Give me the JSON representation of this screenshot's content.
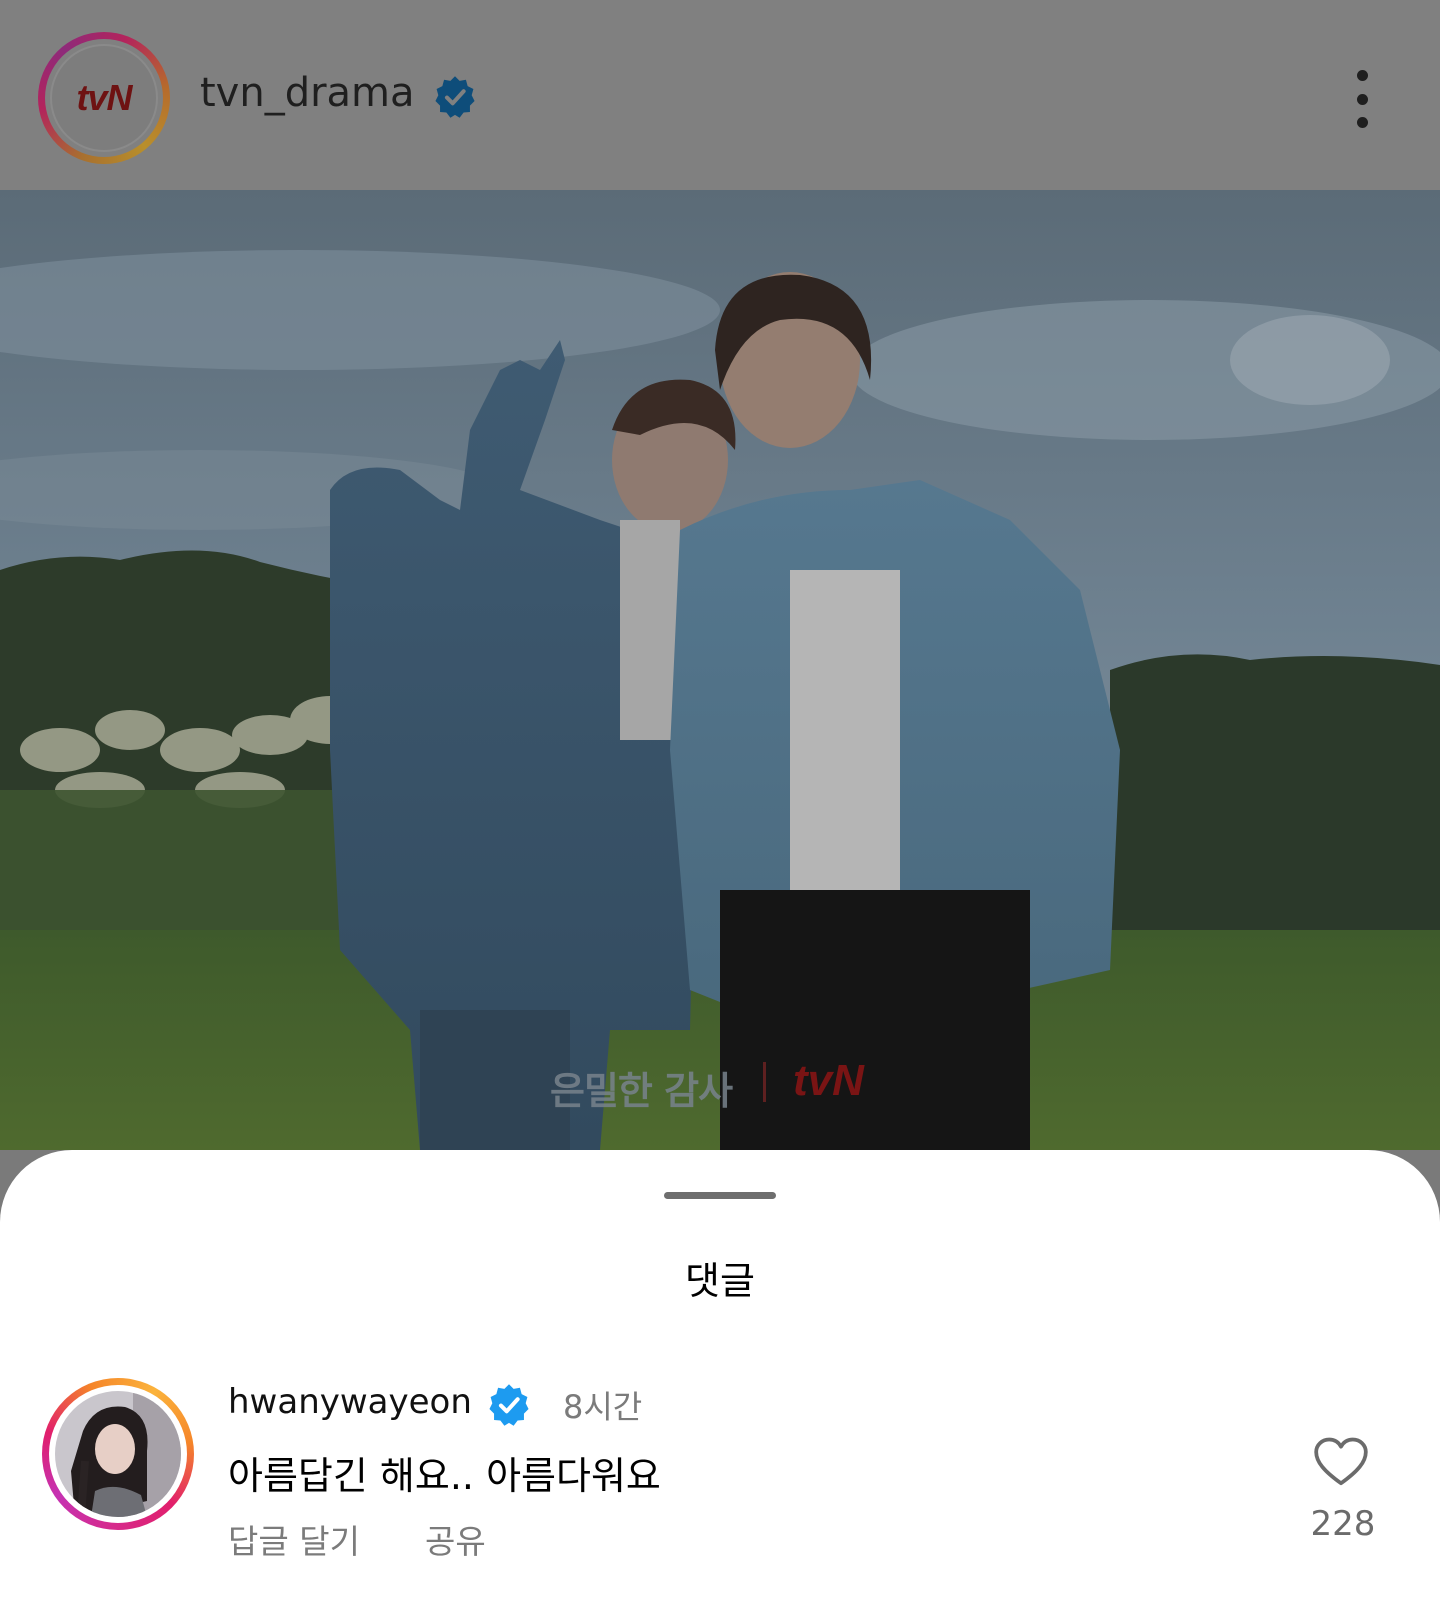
{
  "header": {
    "avatar_logo_text": "tvN",
    "username": "tvn_drama",
    "verified_icon": "verified-badge-icon",
    "more_icon": "more-vertical-icon"
  },
  "post": {
    "image_watermark_title": "은밀한 감사",
    "image_watermark_logo": "tvN"
  },
  "comments_sheet": {
    "title": "댓글",
    "comments": [
      {
        "username": "hwanywayeon",
        "verified_icon": "verified-badge-icon",
        "time": "8시간",
        "text": "아름답긴 해요.. 아름다워요",
        "reply_label": "답글 달기",
        "share_label": "공유",
        "like_icon": "heart-outline-icon",
        "like_count": "228"
      }
    ]
  },
  "colors": {
    "verified_blue": "#1d9bf0",
    "dim_overlay": "#808080",
    "secondary_text": "#7b7b7b"
  }
}
